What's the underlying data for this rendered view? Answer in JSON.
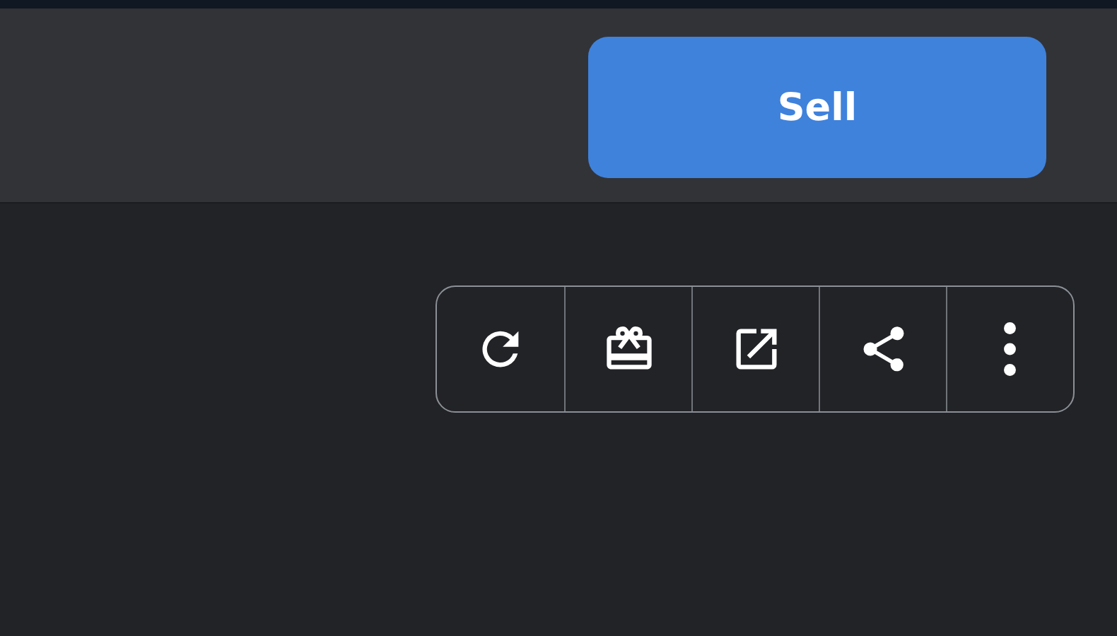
{
  "header": {
    "sell_button": "Sell"
  },
  "toolbar": [
    {
      "kind": "refresh"
    },
    {
      "kind": "gift-card"
    },
    {
      "kind": "external"
    },
    {
      "kind": "share"
    },
    {
      "kind": "more"
    }
  ]
}
